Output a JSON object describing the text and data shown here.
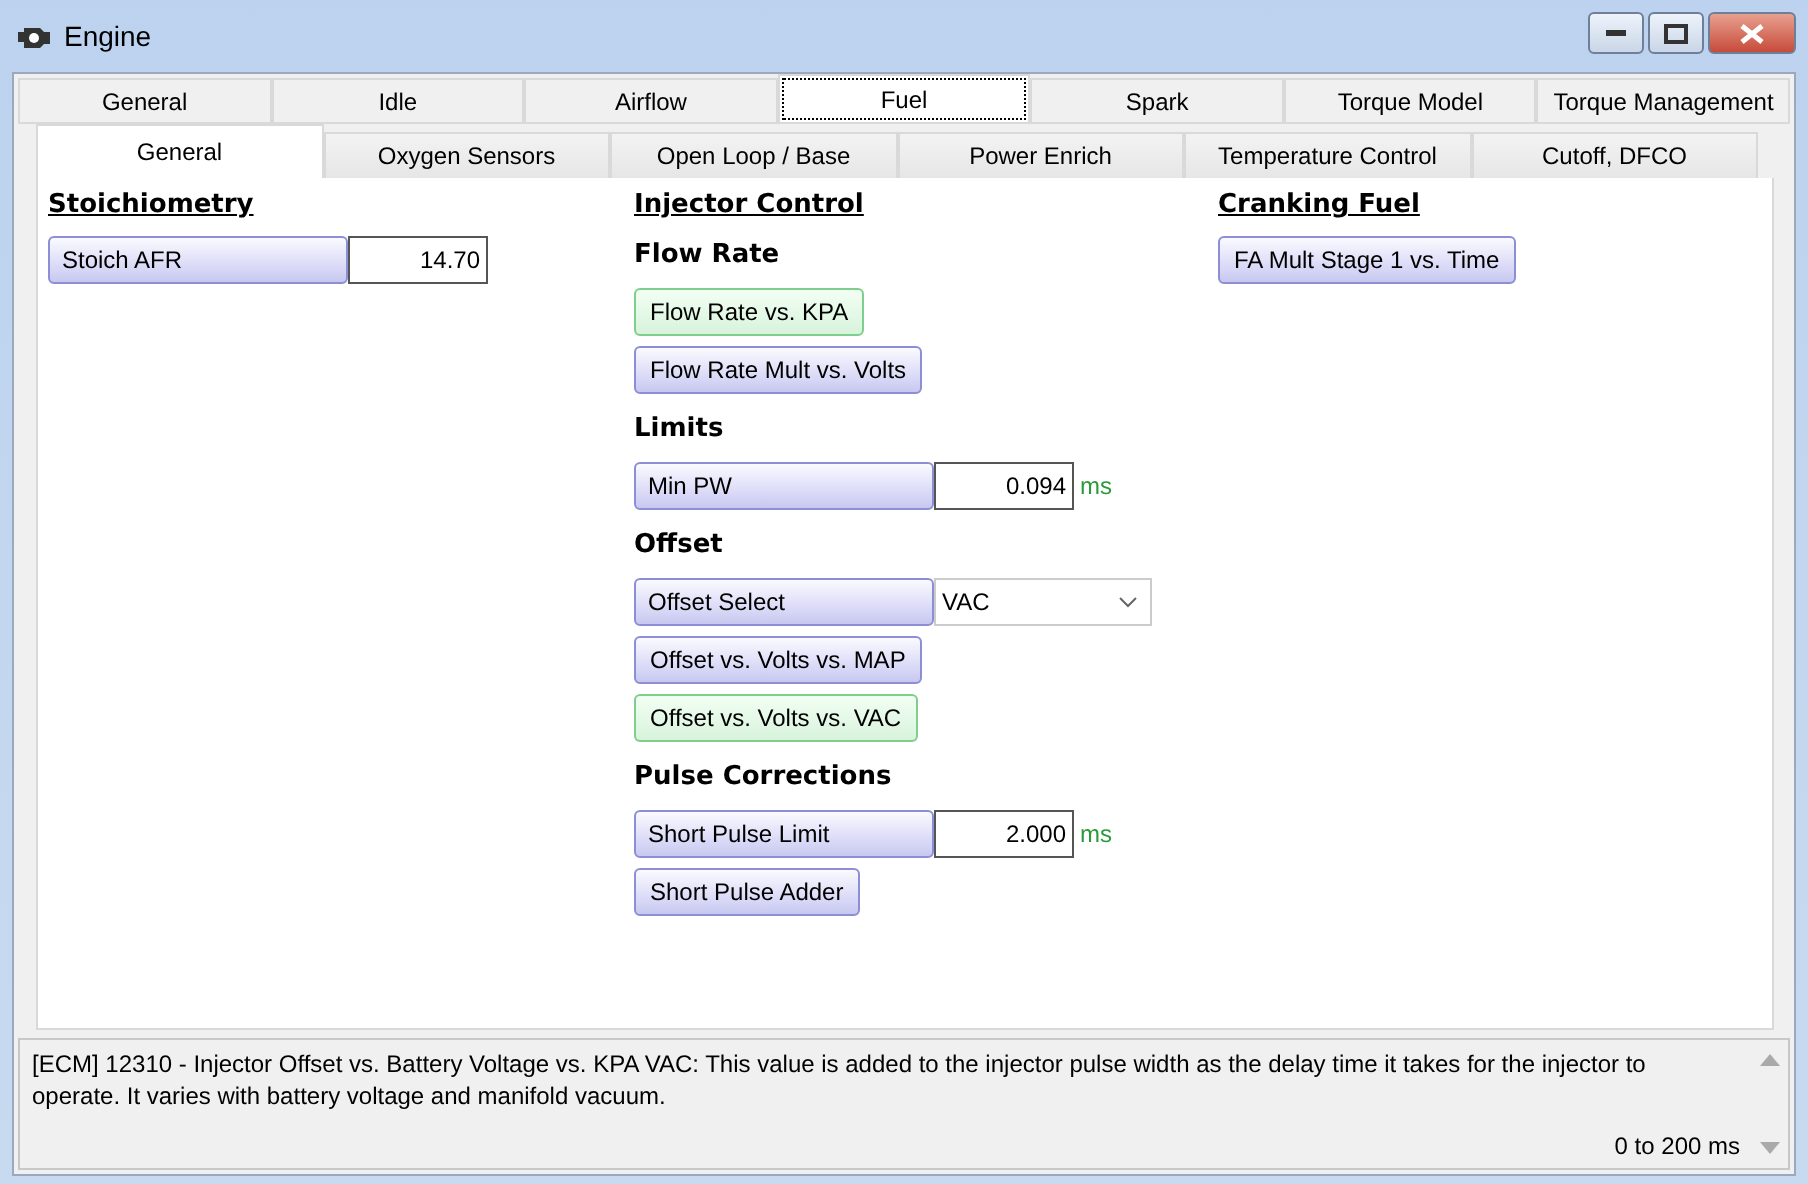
{
  "window": {
    "title": "Engine"
  },
  "tabs": [
    {
      "label": "General",
      "selected": false
    },
    {
      "label": "Idle",
      "selected": false
    },
    {
      "label": "Airflow",
      "selected": false
    },
    {
      "label": "Fuel",
      "selected": true
    },
    {
      "label": "Spark",
      "selected": false
    },
    {
      "label": "Torque Model",
      "selected": false
    },
    {
      "label": "Torque Management",
      "selected": false
    }
  ],
  "subtabs": [
    {
      "label": "General",
      "selected": true
    },
    {
      "label": "Oxygen Sensors",
      "selected": false
    },
    {
      "label": "Open Loop / Base",
      "selected": false
    },
    {
      "label": "Power Enrich",
      "selected": false
    },
    {
      "label": "Temperature Control",
      "selected": false
    },
    {
      "label": "Cutoff, DFCO",
      "selected": false
    }
  ],
  "columns": [
    {
      "heading": "Stoichiometry",
      "groups": [
        {
          "items": [
            {
              "kind": "field",
              "label": "Stoich AFR",
              "value": "14.70"
            }
          ]
        }
      ]
    },
    {
      "heading": "Injector Control",
      "groups": [
        {
          "title": "Flow Rate",
          "items": [
            {
              "kind": "button",
              "label": "Flow Rate vs. KPA",
              "highlighted": true
            },
            {
              "kind": "button",
              "label": "Flow Rate Mult vs. Volts",
              "highlighted": false
            }
          ]
        },
        {
          "title": "Limits",
          "items": [
            {
              "kind": "field",
              "label": "Min PW",
              "value": "0.094",
              "unit": "ms"
            }
          ]
        },
        {
          "title": "Offset",
          "items": [
            {
              "kind": "select",
              "label": "Offset Select",
              "value": "VAC"
            },
            {
              "kind": "button",
              "label": "Offset vs. Volts vs. MAP",
              "highlighted": false
            },
            {
              "kind": "button",
              "label": "Offset vs. Volts vs. VAC",
              "highlighted": true
            }
          ]
        },
        {
          "title": "Pulse Corrections",
          "items": [
            {
              "kind": "field",
              "label": "Short Pulse Limit",
              "value": "2.000",
              "unit": "ms"
            },
            {
              "kind": "button",
              "label": "Short Pulse Adder",
              "highlighted": false
            }
          ]
        }
      ]
    },
    {
      "heading": "Cranking Fuel",
      "groups": [
        {
          "items": [
            {
              "kind": "button",
              "label": "FA Mult Stage 1 vs. Time",
              "highlighted": false
            }
          ]
        }
      ]
    }
  ],
  "info": {
    "description": "[ECM] 12310 - Injector Offset vs. Battery Voltage vs. KPA VAC: This value is added to the injector pulse width as the delay time it takes for the injector to operate. It varies with battery voltage and manifold vacuum.",
    "range": "0 to 200 ms"
  }
}
